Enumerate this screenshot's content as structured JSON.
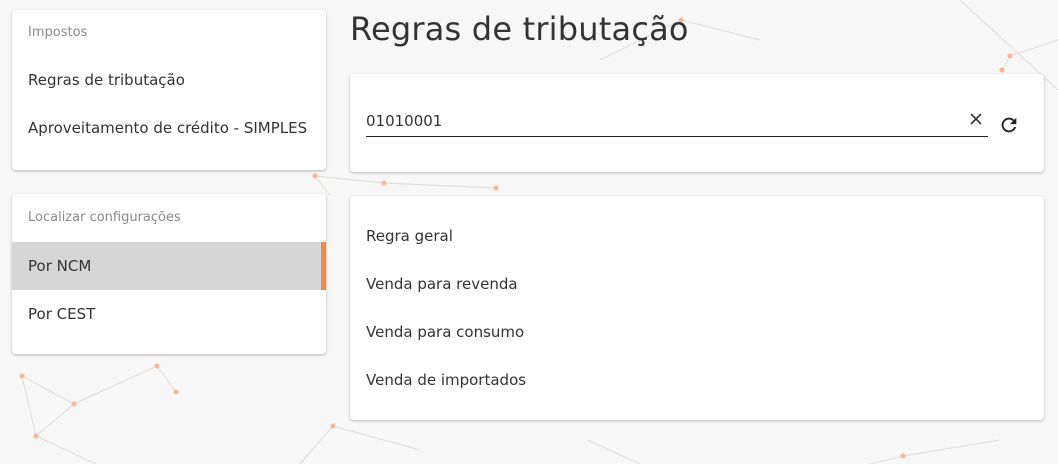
{
  "page_title": "Regras de tributação",
  "impostos_menu": {
    "header": "Impostos",
    "items": [
      {
        "label": "Regras de tributação"
      },
      {
        "label": "Aproveitamento de crédito - SIMPLES"
      }
    ]
  },
  "localizar_menu": {
    "header": "Localizar configurações",
    "items": [
      {
        "label": "Por NCM",
        "active": true
      },
      {
        "label": "Por CEST",
        "active": false
      }
    ]
  },
  "search": {
    "value": "01010001"
  },
  "results": [
    {
      "label": "Regra geral"
    },
    {
      "label": "Venda para revenda"
    },
    {
      "label": "Venda para consumo"
    },
    {
      "label": "Venda de importados"
    }
  ],
  "colors": {
    "accent": "#f5873e",
    "active_bg": "#d6d6d6",
    "background": "#f7f7f7"
  },
  "icons": {
    "clear": "close-icon",
    "refresh": "refresh-icon"
  }
}
